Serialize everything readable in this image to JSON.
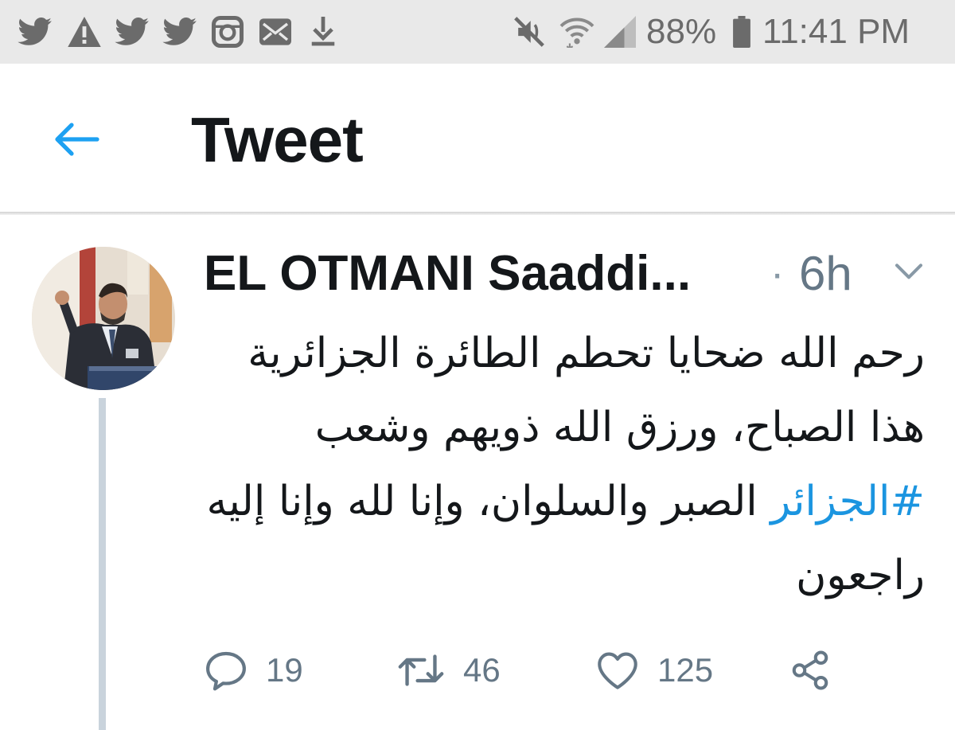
{
  "status_bar": {
    "left_icons": [
      "twitter-icon",
      "warning-icon",
      "twitter-icon",
      "twitter-icon",
      "instagram-icon",
      "mail-icon",
      "download-icon"
    ],
    "right_icons": [
      "mute-icon",
      "wifi-icon",
      "signal-icon",
      "battery-icon"
    ],
    "battery": "88%",
    "time": "11:41 PM"
  },
  "header": {
    "back_icon": "arrow-left-icon",
    "title": "Tweet"
  },
  "tweet": {
    "author": "EL OTMANI Saaddi...",
    "separator": "·",
    "time_ago": "6h",
    "menu_icon": "chevron-down-icon",
    "text_before": "رحم الله ضحايا تحطم الطائرة الجزائرية هذا الصباح، ورزق الله ذويهم وشعب ",
    "hashtag": "#الجزائر",
    "text_after": " الصبر والسلوان، وإنا لله وإنا إليه راجعون",
    "actions": {
      "reply_count": "19",
      "retweet_count": "46",
      "like_count": "125"
    }
  },
  "colors": {
    "status_bar_bg": "#e9e9e9",
    "accent": "#1da1f2",
    "hashtag": "#1b95e0",
    "muted": "#657786",
    "thread_line": "#c9d3dc"
  }
}
